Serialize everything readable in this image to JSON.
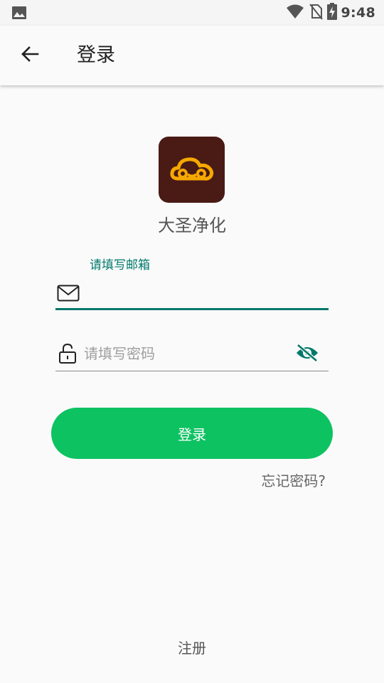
{
  "status_bar": {
    "time": "9:48",
    "icons": [
      "gallery-icon",
      "wifi-icon",
      "no-sim-icon",
      "battery-charging-icon"
    ]
  },
  "app_bar": {
    "title": "登录",
    "back_icon": "arrow-back-icon"
  },
  "brand": {
    "name": "大圣净化",
    "logo_icon": "cloud-logo-icon",
    "logo_bg": "#4a1a15",
    "logo_fg": "#f5a800"
  },
  "form": {
    "email": {
      "label": "请填写邮箱",
      "value": "",
      "icon": "mail-icon"
    },
    "password": {
      "placeholder": "请填写密码",
      "value": "",
      "icon": "lock-icon",
      "toggle_icon": "eye-off-icon"
    },
    "login_label": "登录",
    "forgot_label": "忘记密码?",
    "register_label": "注册"
  },
  "colors": {
    "accent": "#00796b",
    "button": "#0dc261",
    "background": "#fafafa"
  }
}
